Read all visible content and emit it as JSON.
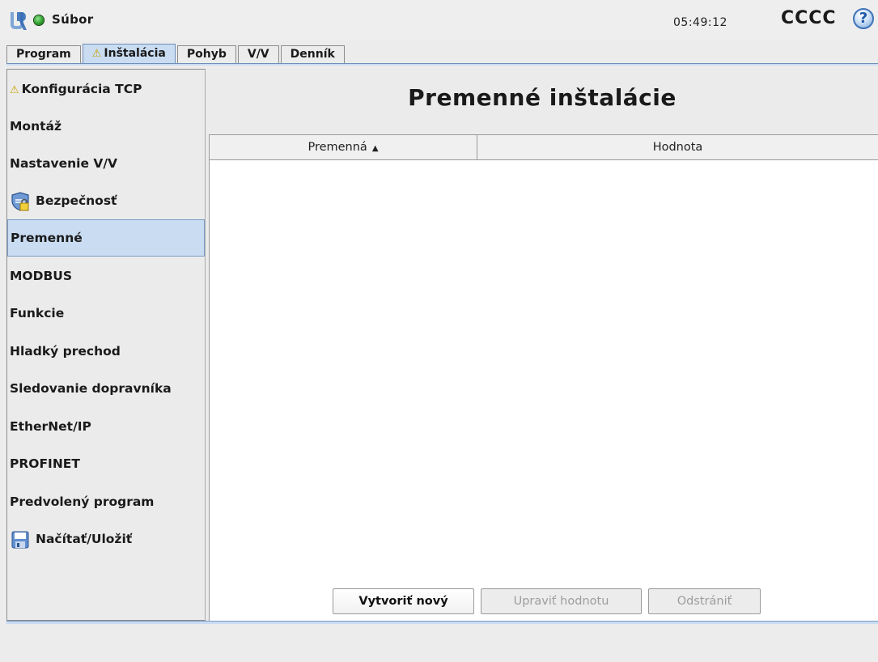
{
  "header": {
    "menu_label": "Súbor",
    "time": "05:49:12",
    "robot_name": "CCCC",
    "help_symbol": "?",
    "logo_icon": "ur-logo-icon",
    "status_color": "#2ea12e"
  },
  "tabs": [
    {
      "label": "Program",
      "warning": false,
      "active": false
    },
    {
      "label": "Inštalácia",
      "warning": true,
      "active": true
    },
    {
      "label": "Pohyb",
      "warning": false,
      "active": false
    },
    {
      "label": "V/V",
      "warning": false,
      "active": false
    },
    {
      "label": "Denník",
      "warning": false,
      "active": false
    }
  ],
  "sidebar": {
    "items": [
      {
        "label": "Konfigurácia TCP",
        "icon": "warning-icon"
      },
      {
        "label": "Montáž"
      },
      {
        "label": "Nastavenie V/V"
      },
      {
        "label": "Bezpečnosť",
        "icon": "safety-shield-icon"
      },
      {
        "label": "Premenné",
        "selected": true
      },
      {
        "label": "MODBUS"
      },
      {
        "label": "Funkcie"
      },
      {
        "label": "Hladký prechod"
      },
      {
        "label": "Sledovanie dopravníka"
      },
      {
        "label": "EtherNet/IP"
      },
      {
        "label": "PROFINET"
      },
      {
        "label": "Predvolený program"
      },
      {
        "label": "Načítať/Uložiť",
        "icon": "floppy-disk-icon"
      }
    ]
  },
  "main": {
    "title": "Premenné inštalácie",
    "table": {
      "columns": [
        "Premenná",
        "Hodnota"
      ],
      "sort_indicator": "▲",
      "rows": []
    },
    "buttons": {
      "create": "Vytvoriť nový",
      "edit": "Upraviť hodnotu",
      "delete": "Odstrániť"
    }
  },
  "colors": {
    "accent": "#c9dcf2",
    "accent_border": "#6f8fb8",
    "warning": "#c9a200",
    "help": "#3f73b8"
  }
}
